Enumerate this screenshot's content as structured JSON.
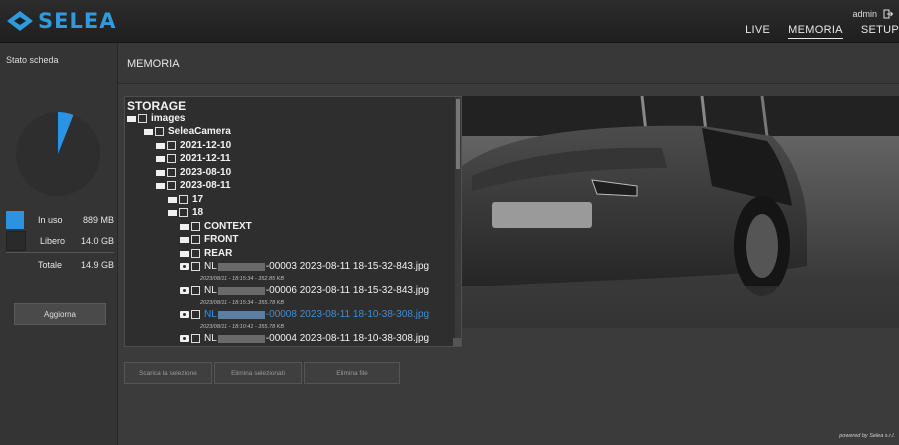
{
  "brand": {
    "name": "SELEA",
    "color": "#2f9bde"
  },
  "user": {
    "name": "admin",
    "logout_icon": "logout-icon"
  },
  "nav": {
    "items": [
      "LIVE",
      "MEMORIA",
      "SETUP"
    ],
    "active": "MEMORIA"
  },
  "sidebar": {
    "title": "Stato scheda",
    "usage": {
      "used_fraction": 0.06,
      "used_color": "#2b93e0",
      "free_color": "#2e2e2e"
    },
    "legend": [
      {
        "label": "In uso",
        "value": "889 MB",
        "color": "#2b93e0"
      },
      {
        "label": "Libero",
        "value": "14.0 GB",
        "color": "#2a2a2a"
      },
      {
        "label": "Totale",
        "value": "14.9 GB"
      }
    ],
    "refresh_label": "Aggiorna"
  },
  "main": {
    "title": "MEMORIA"
  },
  "tree": {
    "root": "STORAGE",
    "folders": {
      "images": "images",
      "camera": "SeleaCamera",
      "d1": "2021-12-10",
      "d2": "2021-12-11",
      "d3": "2023-08-10",
      "d4": "2023-08-11",
      "h17": "17",
      "h18": "18",
      "context": "CONTEXT",
      "front": "FRONT",
      "rear": "REAR"
    },
    "files": [
      {
        "prefix": "NL",
        "suffix": "-00003 2023-08-11 18-15-32-843.jpg",
        "meta": "2023/08/11 - 18:15:34 - 352.85 KB",
        "selected": false
      },
      {
        "prefix": "NL",
        "suffix": "-00006 2023-08-11 18-15-32-843.jpg",
        "meta": "2023/08/11 - 18:15:34 - 355.78 KB",
        "selected": false
      },
      {
        "prefix": "NL",
        "suffix": "-00008 2023-08-11 18-10-38-308.jpg",
        "meta": "2023/08/11 - 18:10:41 - 355.78 KB",
        "selected": true
      },
      {
        "prefix": "NL",
        "suffix": "-00004 2023-08-11 18-10-38-308.jpg",
        "meta": "",
        "selected": false
      }
    ]
  },
  "actions": {
    "download": "Scarica la selezione",
    "delete_selected": "Elimina selezionati",
    "delete_files": "Elimina file"
  },
  "footer": {
    "powered": "powered by Selea s.r.l."
  }
}
